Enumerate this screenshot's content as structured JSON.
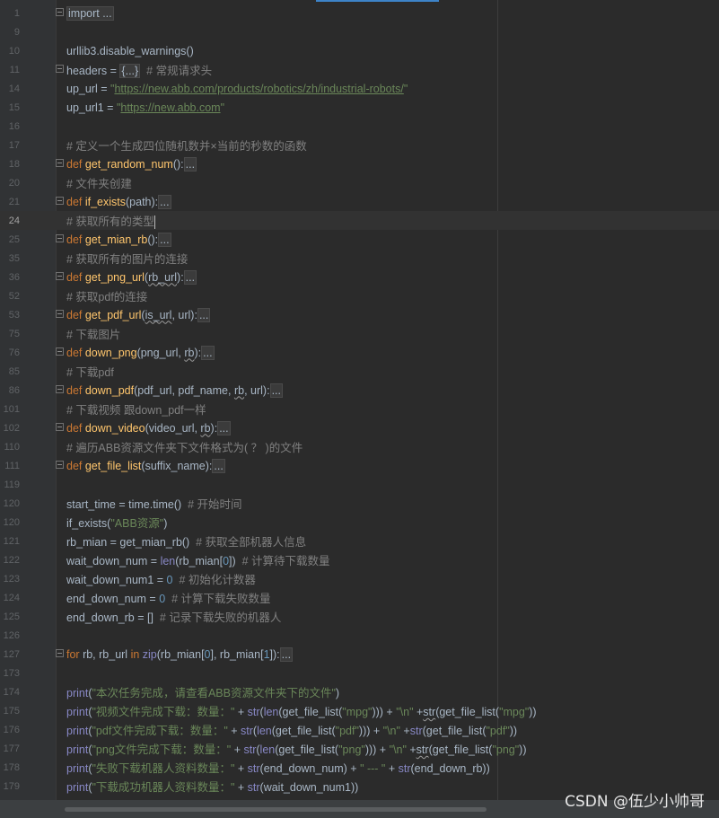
{
  "lines": [
    {
      "n": "1",
      "fold": true,
      "t": [
        [
          "fb",
          "import ..."
        ]
      ]
    },
    {
      "n": "9",
      "t": []
    },
    {
      "n": "10",
      "t": [
        [
          "",
          "urllib3.disable_warnings()"
        ]
      ]
    },
    {
      "n": "11",
      "fold": true,
      "t": [
        [
          "",
          "headers = "
        ],
        [
          "fb",
          "{...}"
        ],
        [
          "",
          "  "
        ],
        [
          "cm",
          "# 常规请求头"
        ]
      ]
    },
    {
      "n": "14",
      "t": [
        [
          "",
          "up_url = "
        ],
        [
          "str",
          "\""
        ],
        [
          "url",
          "https://new.abb.com/products/robotics/zh/industrial-robots/"
        ],
        [
          "str",
          "\""
        ]
      ]
    },
    {
      "n": "15",
      "t": [
        [
          "",
          "up_url1 = "
        ],
        [
          "str",
          "\""
        ],
        [
          "url",
          "https://new.abb.com"
        ],
        [
          "str",
          "\""
        ]
      ]
    },
    {
      "n": "16",
      "t": []
    },
    {
      "n": "17",
      "t": [
        [
          "cm",
          "# 定义一个生成四位随机数并×当前的秒数的函数"
        ]
      ]
    },
    {
      "n": "18",
      "fold": true,
      "t": [
        [
          "kw",
          "def "
        ],
        [
          "fn",
          "get_random_num"
        ],
        [
          "",
          "():"
        ],
        [
          "fb",
          "..."
        ]
      ]
    },
    {
      "n": "20",
      "t": [
        [
          "cm",
          "# 文件夹创建"
        ]
      ]
    },
    {
      "n": "21",
      "fold": true,
      "t": [
        [
          "kw",
          "def "
        ],
        [
          "fn",
          "if_exists"
        ],
        [
          "",
          "(path):"
        ],
        [
          "fb",
          "..."
        ]
      ]
    },
    {
      "n": "24",
      "current": true,
      "caret": true,
      "t": [
        [
          "cm",
          "# 获取所有的类型"
        ]
      ]
    },
    {
      "n": "25",
      "fold": true,
      "t": [
        [
          "kw",
          "def "
        ],
        [
          "fn",
          "get_mian_rb"
        ],
        [
          "",
          "():"
        ],
        [
          "fb",
          "..."
        ]
      ]
    },
    {
      "n": "35",
      "t": [
        [
          "cm",
          "# 获取所有的图片的连接"
        ]
      ]
    },
    {
      "n": "36",
      "fold": true,
      "t": [
        [
          "kw",
          "def "
        ],
        [
          "fn",
          "get_png_url"
        ],
        [
          "",
          "("
        ],
        [
          "sq",
          "rb_url"
        ],
        [
          "",
          "):"
        ],
        [
          "fb",
          "..."
        ]
      ]
    },
    {
      "n": "52",
      "t": [
        [
          "cm",
          "# 获取pdf的连接"
        ]
      ]
    },
    {
      "n": "53",
      "fold": true,
      "t": [
        [
          "kw",
          "def "
        ],
        [
          "fn",
          "get_pdf_url"
        ],
        [
          "",
          "("
        ],
        [
          "sq",
          "is_url"
        ],
        [
          "",
          ", url):"
        ],
        [
          "fb",
          "..."
        ]
      ]
    },
    {
      "n": "75",
      "t": [
        [
          "cm",
          "# 下载图片"
        ]
      ]
    },
    {
      "n": "76",
      "fold": true,
      "t": [
        [
          "kw",
          "def "
        ],
        [
          "fn",
          "down_png"
        ],
        [
          "",
          "(png_url, "
        ],
        [
          "sq",
          "rb"
        ],
        [
          "",
          "):"
        ],
        [
          "fb",
          "..."
        ]
      ]
    },
    {
      "n": "85",
      "t": [
        [
          "cm",
          "# 下载pdf"
        ]
      ]
    },
    {
      "n": "86",
      "fold": true,
      "t": [
        [
          "kw",
          "def "
        ],
        [
          "fn",
          "down_pdf"
        ],
        [
          "",
          "(pdf_url, pdf_name, "
        ],
        [
          "sq",
          "rb"
        ],
        [
          "",
          ", url):"
        ],
        [
          "fb",
          "..."
        ]
      ]
    },
    {
      "n": "101",
      "t": [
        [
          "cm",
          "# 下载视频 跟down_pdf一样"
        ]
      ]
    },
    {
      "n": "102",
      "fold": true,
      "t": [
        [
          "kw",
          "def "
        ],
        [
          "fn",
          "down_video"
        ],
        [
          "",
          "(video_url, "
        ],
        [
          "sq",
          "rb"
        ],
        [
          "",
          "):"
        ],
        [
          "fb",
          "..."
        ]
      ]
    },
    {
      "n": "110",
      "t": [
        [
          "cm",
          "# 遍历ABB资源文件夹下文件格式为( ？ )的文件"
        ]
      ]
    },
    {
      "n": "111",
      "fold": true,
      "t": [
        [
          "kw",
          "def "
        ],
        [
          "fn",
          "get_file_list"
        ],
        [
          "",
          "(suffix_name):"
        ],
        [
          "fb",
          "..."
        ]
      ]
    },
    {
      "n": "119",
      "t": []
    },
    {
      "n": "120",
      "t": [
        [
          "",
          "start_time = time.time()  "
        ],
        [
          "cm",
          "# 开始时间"
        ]
      ]
    },
    {
      "n": "120",
      "t": [
        [
          "",
          "if_exists("
        ],
        [
          "str",
          "\"ABB资源\""
        ],
        [
          "",
          ")"
        ]
      ]
    },
    {
      "n": "121",
      "t": [
        [
          "",
          "rb_mian = get_mian_rb()  "
        ],
        [
          "cm",
          "# 获取全部机器人信息"
        ]
      ]
    },
    {
      "n": "122",
      "t": [
        [
          "",
          "wait_down_num = "
        ],
        [
          "bi",
          "len"
        ],
        [
          "",
          "(rb_mian["
        ],
        [
          "num",
          "0"
        ],
        [
          "",
          "])  "
        ],
        [
          "cm",
          "# 计算待下载数量"
        ]
      ]
    },
    {
      "n": "123",
      "t": [
        [
          "",
          "wait_down_num1 = "
        ],
        [
          "num",
          "0"
        ],
        [
          "",
          "  "
        ],
        [
          "cm",
          "# 初始化计数器"
        ]
      ]
    },
    {
      "n": "124",
      "t": [
        [
          "",
          "end_down_num = "
        ],
        [
          "num",
          "0"
        ],
        [
          "",
          "  "
        ],
        [
          "cm",
          "# 计算下载失败数量"
        ]
      ]
    },
    {
      "n": "125",
      "t": [
        [
          "",
          "end_down_rb = []  "
        ],
        [
          "cm",
          "# 记录下载失败的机器人"
        ]
      ]
    },
    {
      "n": "126",
      "t": []
    },
    {
      "n": "127",
      "fold": true,
      "t": [
        [
          "kw",
          "for "
        ],
        [
          "",
          "rb, rb_url "
        ],
        [
          "kw",
          "in "
        ],
        [
          "bi",
          "zip"
        ],
        [
          "",
          "(rb_mian["
        ],
        [
          "num",
          "0"
        ],
        [
          "",
          "], rb_mian["
        ],
        [
          "num",
          "1"
        ],
        [
          "",
          "]):"
        ],
        [
          "fb",
          "..."
        ]
      ]
    },
    {
      "n": "173",
      "t": []
    },
    {
      "n": "174",
      "t": [
        [
          "bi",
          "print"
        ],
        [
          "",
          "("
        ],
        [
          "str",
          "\"本次任务完成，请查看ABB资源文件夹下的文件\""
        ],
        [
          "",
          ")"
        ]
      ]
    },
    {
      "n": "175",
      "t": [
        [
          "bi",
          "print"
        ],
        [
          "",
          "("
        ],
        [
          "str",
          "\"视频文件完成下载：数量：\""
        ],
        [
          "",
          " + "
        ],
        [
          "bi",
          "str"
        ],
        [
          "",
          "("
        ],
        [
          "bi",
          "len"
        ],
        [
          "",
          "(get_file_list("
        ],
        [
          "str",
          "\"mpg\""
        ],
        [
          "",
          "))) + "
        ],
        [
          "str",
          "\"\\n\""
        ],
        [
          "",
          " +"
        ],
        [
          "sq",
          "str"
        ],
        [
          "",
          "(get_file_list("
        ],
        [
          "str",
          "\"mpg\""
        ],
        [
          "",
          "))"
        ]
      ]
    },
    {
      "n": "176",
      "t": [
        [
          "bi",
          "print"
        ],
        [
          "",
          "("
        ],
        [
          "str",
          "\"pdf文件完成下载：数量：\""
        ],
        [
          "",
          " + "
        ],
        [
          "bi",
          "str"
        ],
        [
          "",
          "("
        ],
        [
          "bi",
          "len"
        ],
        [
          "",
          "(get_file_list("
        ],
        [
          "str",
          "\"pdf\""
        ],
        [
          "",
          "))) + "
        ],
        [
          "str",
          "\"\\n\""
        ],
        [
          "",
          " +"
        ],
        [
          "bi",
          "str"
        ],
        [
          "",
          "(get_file_list("
        ],
        [
          "str",
          "\"pdf\""
        ],
        [
          "",
          "))"
        ]
      ]
    },
    {
      "n": "177",
      "t": [
        [
          "bi",
          "print"
        ],
        [
          "",
          "("
        ],
        [
          "str",
          "\"png文件完成下载：数量：\""
        ],
        [
          "",
          " + "
        ],
        [
          "bi",
          "str"
        ],
        [
          "",
          "("
        ],
        [
          "bi",
          "len"
        ],
        [
          "",
          "(get_file_list("
        ],
        [
          "str",
          "\"png\""
        ],
        [
          "",
          "))) + "
        ],
        [
          "str",
          "\"\\n\""
        ],
        [
          "",
          " +"
        ],
        [
          "sq",
          "str"
        ],
        [
          "",
          "(get_file_list("
        ],
        [
          "str",
          "\"png\""
        ],
        [
          "",
          "))"
        ]
      ]
    },
    {
      "n": "178",
      "t": [
        [
          "bi",
          "print"
        ],
        [
          "",
          "("
        ],
        [
          "str",
          "\"失败下载机器人资料数量：\""
        ],
        [
          "",
          " + "
        ],
        [
          "bi",
          "str"
        ],
        [
          "",
          "(end_down_num) + "
        ],
        [
          "str",
          "\" --- \""
        ],
        [
          "",
          " + "
        ],
        [
          "bi",
          "str"
        ],
        [
          "",
          "(end_down_rb))"
        ]
      ]
    },
    {
      "n": "179",
      "t": [
        [
          "bi",
          "print"
        ],
        [
          "",
          "("
        ],
        [
          "str",
          "\"下载成功机器人资料数量：\""
        ],
        [
          "",
          " + "
        ],
        [
          "bi",
          "str"
        ],
        [
          "",
          "(wait_down_num1))"
        ]
      ]
    }
  ],
  "watermark": "CSDN @伍少小帅哥"
}
